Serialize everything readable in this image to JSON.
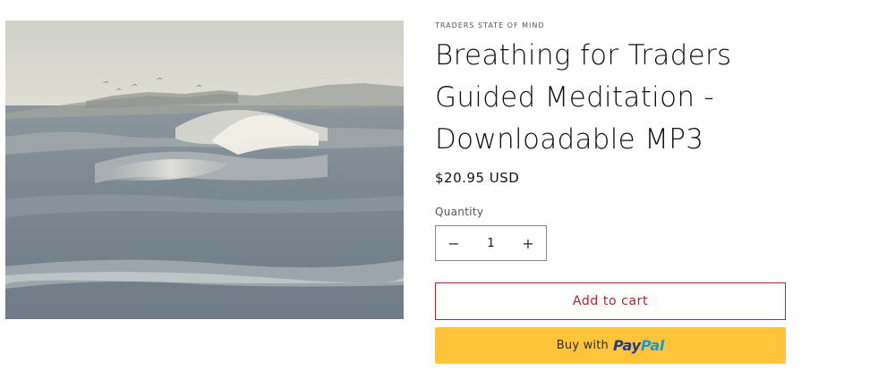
{
  "product": {
    "vendor": "TRADERS STATE OF MIND",
    "title": "Breathing for Traders Guided Meditation - Downloadable MP3",
    "price": "$20.95 USD",
    "image_alt": "Ocean waves breaking near the shore"
  },
  "quantity": {
    "label": "Quantity",
    "value": "1",
    "decrease_symbol": "−",
    "increase_symbol": "+"
  },
  "buttons": {
    "add_to_cart": "Add to cart",
    "buy_with_prefix": "Buy with",
    "paypal_pay": "Pay",
    "paypal_pal": "Pal"
  },
  "colors": {
    "accent": "#b8232f",
    "paypal_yellow": "#ffc439",
    "paypal_dark_blue": "#253b80",
    "paypal_light_blue": "#179bd7"
  }
}
